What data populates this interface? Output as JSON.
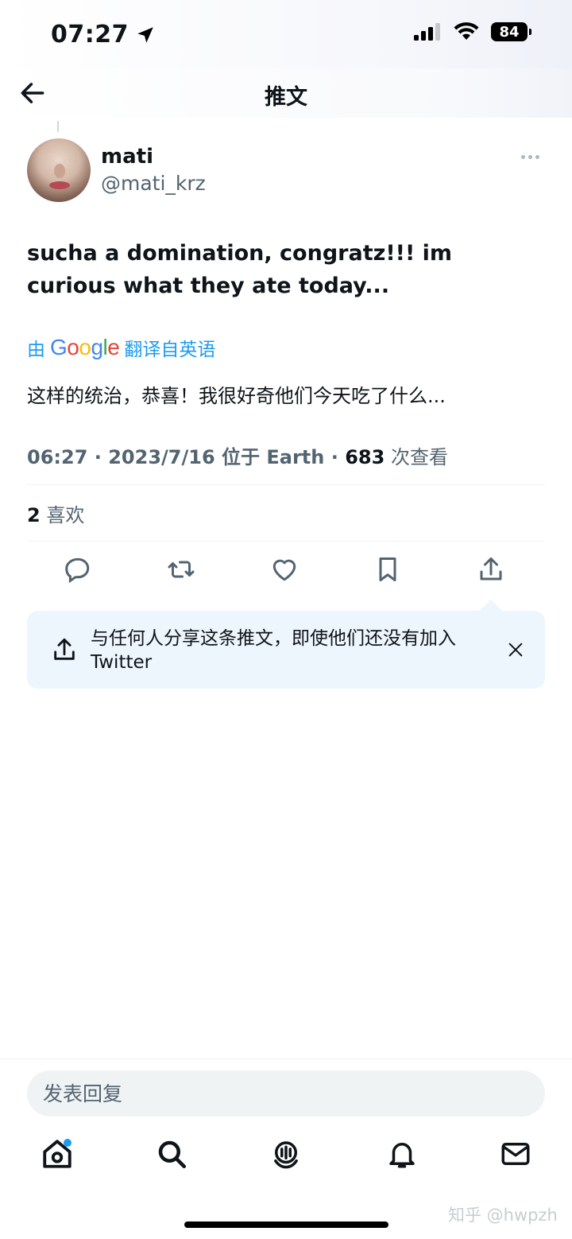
{
  "status_bar": {
    "time": "07:27",
    "battery": "84"
  },
  "header": {
    "title": "推文"
  },
  "tweet": {
    "display_name": "mati",
    "handle": "@mati_krz",
    "text": "sucha a domination, congratz!!! im curious what they ate today...",
    "translate": {
      "prefix": "由",
      "provider_parts": [
        "G",
        "o",
        "o",
        "g",
        "l",
        "e"
      ],
      "suffix": "翻译自英语"
    },
    "translated_text": "这样的统治，恭喜！我很好奇他们今天吃了什么...",
    "meta": {
      "time": "06:27",
      "sep1": " · ",
      "date": "2023/7/16",
      "location": " 位于 Earth",
      "sep2": " · ",
      "views": "683",
      "views_label": " 次查看"
    },
    "likes": {
      "count": "2",
      "label": " 喜欢"
    }
  },
  "share_card": {
    "text": "与任何人分享这条推文，即使他们还没有加入 Twitter"
  },
  "reply": {
    "placeholder": "发表回复"
  },
  "watermark": "知乎 @hwpzh",
  "colors": {
    "accent": "#1d9bf0",
    "secondary_text": "#536471",
    "card_bg": "#ecf6fc"
  },
  "icons": {
    "actions": [
      "reply-icon",
      "retweet-icon",
      "like-icon",
      "bookmark-icon",
      "share-icon"
    ],
    "tabs": [
      "home-icon",
      "search-icon",
      "spaces-icon",
      "notifications-icon",
      "messages-icon"
    ]
  }
}
